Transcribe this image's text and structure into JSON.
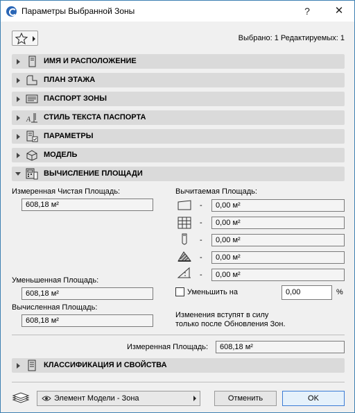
{
  "window": {
    "title": "Параметры Выбранной Зоны",
    "help_label": "?",
    "close_label": "✕"
  },
  "header": {
    "selection_info": "Выбрано: 1 Редактируемых: 1"
  },
  "sections": [
    {
      "label": "ИМЯ И РАСПОЛОЖЕНИЕ",
      "icon": "name-location-icon",
      "expanded": false
    },
    {
      "label": "ПЛАН ЭТАЖА",
      "icon": "floor-plan-icon",
      "expanded": false
    },
    {
      "label": "ПАСПОРТ ЗОНЫ",
      "icon": "zone-stamp-icon",
      "expanded": false
    },
    {
      "label": "СТИЛЬ ТЕКСТА ПАСПОРТА",
      "icon": "text-style-icon",
      "expanded": false
    },
    {
      "label": "ПАРАМЕТРЫ",
      "icon": "parameters-icon",
      "expanded": false
    },
    {
      "label": "МОДЕЛЬ",
      "icon": "model-icon",
      "expanded": false
    },
    {
      "label": "ВЫЧИСЛЕНИЕ ПЛОЩАДИ",
      "icon": "area-calculation-icon",
      "expanded": true
    }
  ],
  "area": {
    "measured_net_label": "Измеренная Чистая Площадь:",
    "measured_net_value": "608,18 м²",
    "deducted_label": "Вычитаемая Площадь:",
    "deductions": [
      {
        "icon": "low-ceiling-icon",
        "dash": "-",
        "value": "0,00 м²"
      },
      {
        "icon": "wall-inset-icon",
        "dash": "-",
        "value": "0,00 м²"
      },
      {
        "icon": "column-icon",
        "dash": "-",
        "value": "0,00 м²"
      },
      {
        "icon": "fill-icon",
        "dash": "-",
        "value": "0,00 м²"
      },
      {
        "icon": "slanted-ceiling-icon",
        "dash": "-",
        "value": "0,00 м²"
      }
    ],
    "reduced_label": "Уменьшенная Площадь:",
    "reduced_value": "608,18 м²",
    "reduce_by_label": "Уменьшить на",
    "reduce_by_value": "0,00",
    "reduce_by_unit": "%",
    "calculated_label": "Вычисленная Площадь:",
    "calculated_value": "608,18 м²",
    "note_line1": "Изменения вступят в силу",
    "note_line2": "только после Обновления Зон.",
    "measured_label": "Измеренная Площадь:",
    "measured_value": "608,18 м²"
  },
  "classification": {
    "label": "КЛАССИФИКАЦИЯ И СВОЙСТВА",
    "icon": "classification-icon"
  },
  "footer": {
    "layer_combo_value": "Элемент Модели - Зона",
    "cancel_label": "Отменить",
    "ok_label": "OK"
  },
  "colors": {
    "section_bg": "#dadada",
    "window_border": "#3c7fb1",
    "ok_border": "#3a7bd5"
  }
}
